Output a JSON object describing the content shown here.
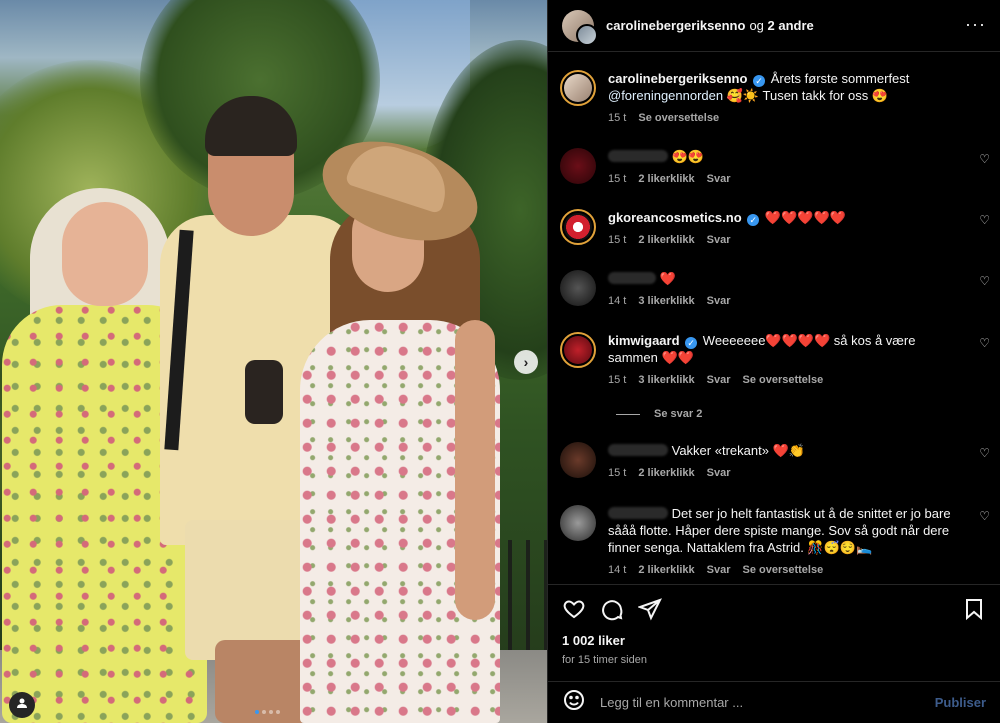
{
  "header": {
    "username": "carolinebergeriksenno",
    "rest_og": "og",
    "rest_others": "2 andre",
    "more_icon": "more-horizontal-icon"
  },
  "caption": {
    "username": "carolinebergeriksenno",
    "verified_mark": "✓",
    "text": "Årets første sommerfest",
    "mention": "@foreningennorden",
    "text_after": "🥰☀️ Tusen takk for oss 😍",
    "time": "15 t",
    "translate": "Se oversettelse"
  },
  "comments": [
    {
      "username": "",
      "text": "😍😍",
      "time": "15 t",
      "likes": "2 likerklikk",
      "reply": "Svar"
    },
    {
      "username": "gkoreancosmetics.no",
      "text": "❤️❤️❤️❤️❤️",
      "time": "15 t",
      "likes": "2 likerklikk",
      "reply": "Svar"
    },
    {
      "username": "",
      "text": "❤️",
      "time": "14 t",
      "likes": "3 likerklikk",
      "reply": "Svar"
    },
    {
      "username": "kimwigaard",
      "text": "Weeeeeee❤️❤️❤️❤️ så kos å være sammen ❤️❤️",
      "time": "15 t",
      "likes": "3 likerklikk",
      "reply": "Svar",
      "translate": "Se oversettelse"
    },
    {
      "username": "",
      "text": "Vakker «trekant» ❤️👏",
      "time": "15 t",
      "likes": "2 likerklikk",
      "reply": "Svar"
    },
    {
      "username": "",
      "text": "Det ser jo helt fantastisk ut å de snittet er jo bare sååå flotte. Håper dere spiste mange. Sov så godt når dere finner senga. Nattaklem fra Astrid. 🎊😴😌🛌",
      "time": "14 t",
      "likes": "2 likerklikk",
      "reply": "Svar",
      "translate": "Se oversettelse"
    }
  ],
  "replies_toggle": "Se svar 2",
  "actions": {
    "likes": "1 002 liker",
    "when": "for 15 timer siden"
  },
  "add_comment": {
    "placeholder": "Legg til en kommentar ...",
    "post": "Publiser"
  },
  "photo": {
    "dots": 4,
    "active_dot": 0
  }
}
